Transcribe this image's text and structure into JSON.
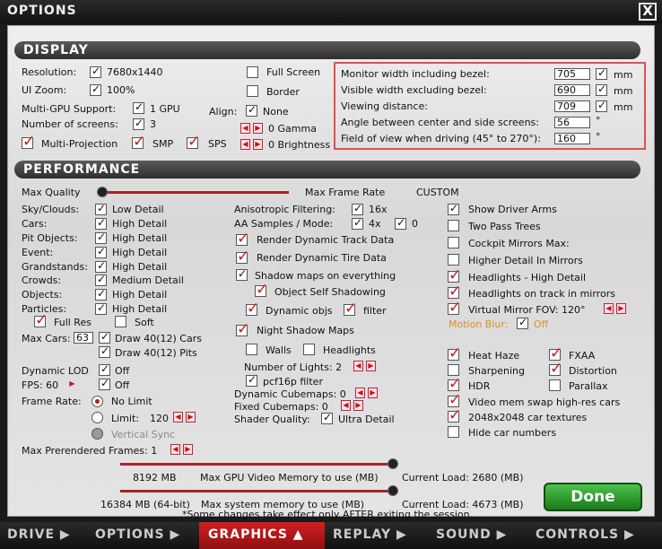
{
  "window": {
    "title": "OPTIONS",
    "close": "X"
  },
  "display": {
    "header": "DISPLAY",
    "resolution": {
      "label": "Resolution:",
      "value": "7680x1440"
    },
    "ui_zoom": {
      "label": "UI Zoom:",
      "value": "100%"
    },
    "multigpu": {
      "label": "Multi-GPU Support:",
      "value": "1 GPU"
    },
    "screens": {
      "label": "Number of screens:",
      "value": "3"
    },
    "multiprojection": "Multi-Projection",
    "smp": "SMP",
    "sps": "SPS",
    "fullscreen": "Full Screen",
    "border": "Border",
    "align": {
      "label": "Align:",
      "value": "None"
    },
    "gamma": "0  Gamma",
    "brightness": "0  Brightness",
    "monitor_width": {
      "label": "Monitor width including bezel:",
      "value": "705",
      "unit": "mm"
    },
    "visible_width": {
      "label": "Visible width excluding bezel:",
      "value": "690",
      "unit": "mm"
    },
    "viewing_distance": {
      "label": "Viewing distance:",
      "value": "709",
      "unit": "mm"
    },
    "angle": {
      "label": "Angle between center and side screens:",
      "value": "56",
      "unit": "°"
    },
    "fov": {
      "label": "Field of view when driving (45° to 270°):",
      "value": "160",
      "unit": "°"
    }
  },
  "performance": {
    "header": "PERFORMANCE",
    "max_quality": "Max Quality",
    "max_frame_rate": "Max Frame Rate",
    "preset": "CUSTOM",
    "left": [
      {
        "label": "Sky/Clouds:",
        "value": "Low Detail"
      },
      {
        "label": "Cars:",
        "value": "High Detail"
      },
      {
        "label": "Pit Objects:",
        "value": "High Detail"
      },
      {
        "label": "Event:",
        "value": "High Detail"
      },
      {
        "label": "Grandstands:",
        "value": "High Detail"
      },
      {
        "label": "Crowds:",
        "value": "Medium Detail"
      },
      {
        "label": "Objects:",
        "value": "High Detail"
      },
      {
        "label": "Particles:",
        "value": "High Detail"
      }
    ],
    "full_res": "Full Res",
    "soft": "Soft",
    "max_cars": {
      "label": "Max Cars:",
      "value": "63"
    },
    "draw_cars": "Draw 40(12) Cars",
    "draw_pits": "Draw 40(12) Pits",
    "dynamic_lod": {
      "label": "Dynamic LOD",
      "value": "Off"
    },
    "fps": {
      "label": "FPS: 60",
      "value": "Off"
    },
    "frame_rate": {
      "label": "Frame Rate:",
      "no_limit": "No Limit",
      "limit": "Limit:",
      "limit_value": "120",
      "vsync": "Vertical Sync"
    },
    "prerendered": "Max Prerendered Frames: 1",
    "aniso": {
      "label": "Anisotropic Filtering:",
      "value": "16x"
    },
    "aa": {
      "label": "AA Samples / Mode:",
      "value": "4x",
      "mode": "0"
    },
    "render_track": "Render Dynamic Track Data",
    "render_tire": "Render Dynamic Tire Data",
    "shadow_all": "Shadow maps on everything",
    "self_shadow": "Object Self Shadowing",
    "dynamic_objs": "Dynamic objs",
    "filter": "filter",
    "night_shadow": "Night Shadow Maps",
    "walls": "Walls",
    "headlights": "Headlights",
    "num_lights": "Number of Lights: 2",
    "pcf": "pcf16p filter",
    "dyn_cube": "Dynamic Cubemaps: 0",
    "fixed_cube": "Fixed Cubemaps: 0",
    "shader": {
      "label": "Shader Quality:",
      "value": "Ultra Detail"
    },
    "right": {
      "show_arms": "Show Driver Arms",
      "two_pass": "Two Pass Trees",
      "cockpit_mirrors": "Cockpit Mirrors  Max:",
      "higher_detail": "Higher Detail In Mirrors",
      "headlights_hd": "Headlights - High Detail",
      "headlights_mirrors": "Headlights on track in mirrors",
      "virtual_mirror": "Virtual Mirror  FOV:  120°",
      "motion_blur": "Motion Blur:",
      "motion_blur_value": "Off",
      "heat_haze": "Heat Haze",
      "fxaa": "FXAA",
      "sharpening": "Sharpening",
      "distortion": "Distortion",
      "hdr": "HDR",
      "parallax": "Parallax",
      "vmem_swap": "Video mem swap high-res cars",
      "tex2048": "2048x2048 car textures",
      "hide_numbers": "Hide car numbers"
    },
    "gpu_mem": {
      "value": "8192 MB",
      "label": "Max GPU Video Memory to use (MB)",
      "current": "Current Load: 2680 (MB)"
    },
    "sys_mem": {
      "value": "16384 MB (64-bit)",
      "label": "Max system memory to use (MB)",
      "current": "Current Load: 4673 (MB)"
    },
    "note": "*Some changes take effect only AFTER exiting the session."
  },
  "done": "Done",
  "nav": [
    "DRIVE ▶",
    "OPTIONS ▶",
    "GRAPHICS ▲",
    "REPLAY ▶",
    "SOUND ▶",
    "CONTROLS ▶"
  ]
}
